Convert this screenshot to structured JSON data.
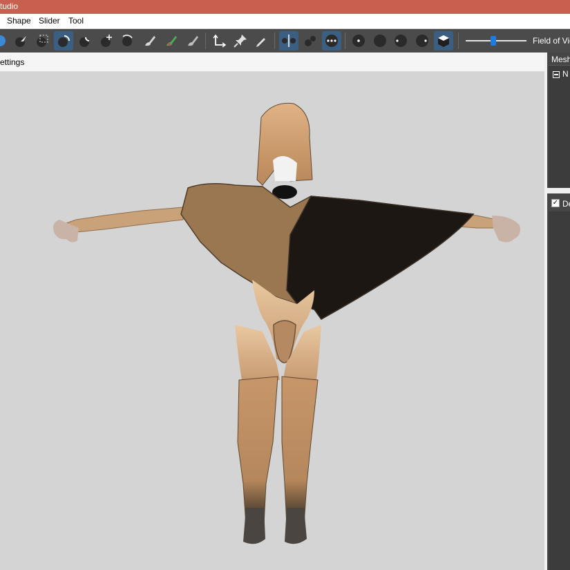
{
  "window": {
    "title": "tudio"
  },
  "menu": {
    "items": [
      "Shape",
      "Slider",
      "Tool"
    ]
  },
  "toolbar": {
    "field_of_view_label": "Field of Vie",
    "field_of_view_level": 0.45,
    "buttons": [
      {
        "icon": "partial-tool-icon"
      },
      {
        "icon": "select-arrow-icon"
      },
      {
        "icon": "mask-select-icon"
      },
      {
        "icon": "inflate-brush-icon",
        "active": true
      },
      {
        "icon": "deflate-brush-icon"
      },
      {
        "icon": "move-brush-icon"
      },
      {
        "icon": "smooth-brush-icon"
      },
      {
        "icon": "weight-brush-icon"
      },
      {
        "icon": "color-brush-icon"
      },
      {
        "icon": "alpha-brush-icon"
      },
      {
        "icon": "transform-axes-icon"
      },
      {
        "icon": "pivot-pin-icon"
      },
      {
        "icon": "vertex-edit-icon"
      },
      {
        "icon": "x-mirror-icon",
        "active": true
      },
      {
        "icon": "connected-only-icon"
      },
      {
        "icon": "global-brush-icon",
        "active": true
      },
      {
        "icon": "show-vertices-icon"
      },
      {
        "icon": "show-mask-icon"
      },
      {
        "icon": "show-weights-icon"
      },
      {
        "icon": "show-colors-icon"
      },
      {
        "icon": "solid-cube-icon",
        "active": true
      }
    ]
  },
  "tabstrip": {
    "label": "ettings"
  },
  "sidebar": {
    "mesh_panel_title": "Mesh",
    "mesh_tree_item": "N",
    "details_checkbox_label": "De",
    "details_checked": true
  },
  "colors": {
    "titlebar": "#c9604f",
    "toolbar": "#4b4b4b",
    "viewport": "#d4d4d4",
    "active_button": "#3b5f82",
    "slider_thumb": "#1e7be0",
    "panel": "#3c3c3c"
  }
}
